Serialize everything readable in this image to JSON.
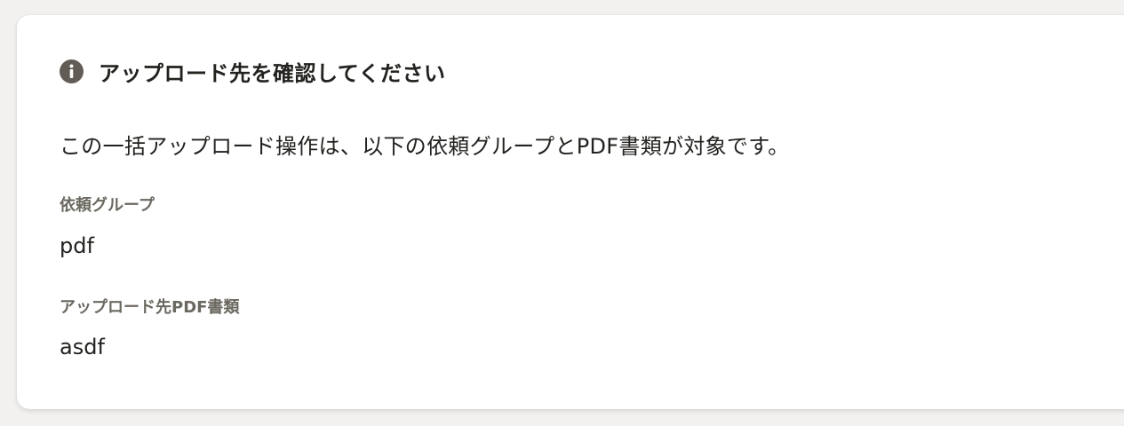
{
  "dialog": {
    "title": "アップロード先を確認してください",
    "icon": "info-circle-icon",
    "description": "この一括アップロード操作は、以下の依頼グループとPDF書類が対象です。",
    "fields": {
      "request_group": {
        "label": "依頼グループ",
        "value": "pdf"
      },
      "target_document": {
        "label": "アップロード先PDF書類",
        "value": "asdf"
      }
    }
  },
  "colors": {
    "icon": "#615d56",
    "label": "#6b6860",
    "text": "#23221f",
    "background": "#f2f1ef"
  }
}
